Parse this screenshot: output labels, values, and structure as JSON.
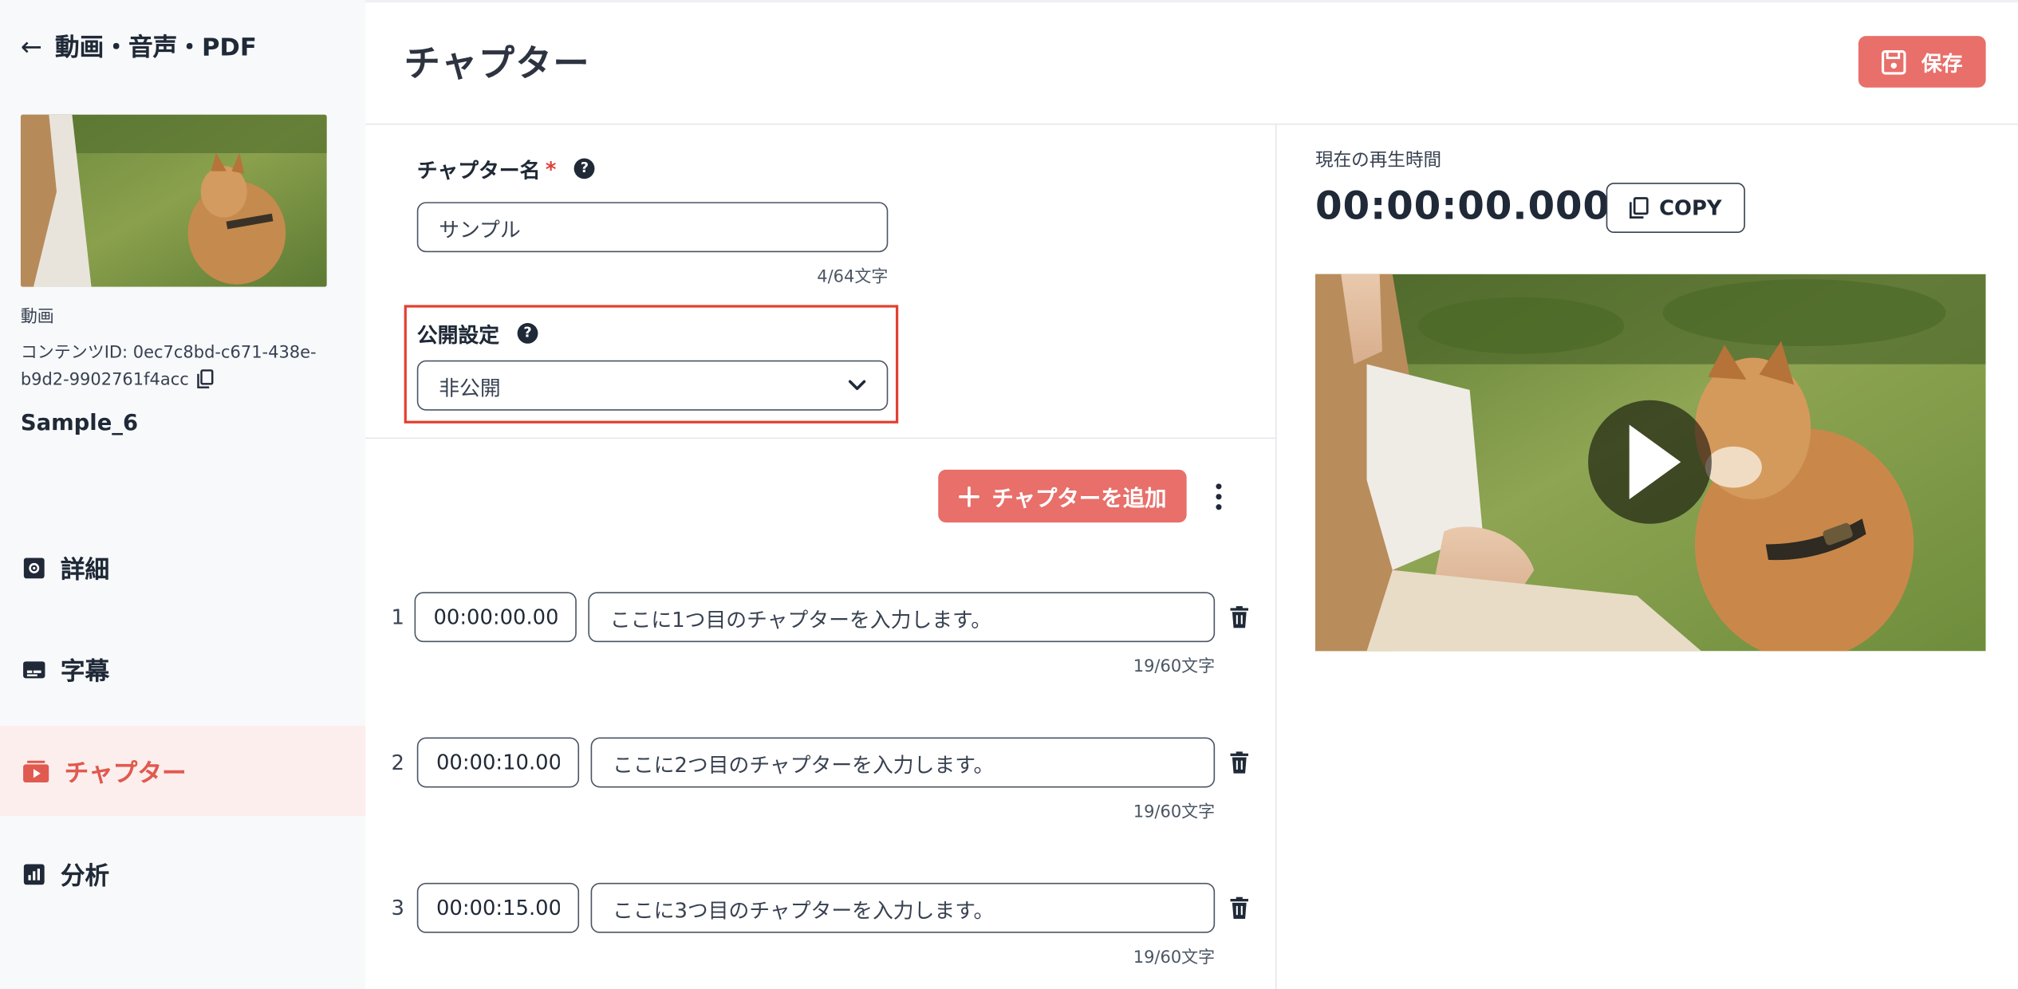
{
  "sidebar": {
    "back_title": "動画・音声・PDF",
    "content_type": "動画",
    "content_id": "コンテンツID: 0ec7c8bd-c671-438e-b9d2-9902761f4acc",
    "content_title": "Sample_6",
    "nav": [
      {
        "label": "詳細",
        "icon": "gear-icon",
        "active": false
      },
      {
        "label": "字幕",
        "icon": "subtitles-icon",
        "active": false
      },
      {
        "label": "チャプター",
        "icon": "chapter-icon",
        "active": true
      },
      {
        "label": "分析",
        "icon": "analytics-icon",
        "active": false
      }
    ]
  },
  "header": {
    "title": "チャプター",
    "save_label": "保存"
  },
  "form": {
    "name_label": "チャプター名",
    "name_required_mark": "*",
    "name_value": "サンプル",
    "name_count": "4/64文字",
    "publish_label": "公開設定",
    "publish_value": "非公開",
    "add_chapter_label": "チャプターを追加"
  },
  "chapters": [
    {
      "number": "1",
      "time": "00:00:00.000",
      "text": "ここに1つ目のチャプターを入力します。",
      "count": "19/60文字"
    },
    {
      "number": "2",
      "time": "00:00:10.000",
      "text": "ここに2つ目のチャプターを入力します。",
      "count": "19/60文字"
    },
    {
      "number": "3",
      "time": "00:00:15.000",
      "text": "ここに3つ目のチャプターを入力します。",
      "count": "19/60文字"
    }
  ],
  "player": {
    "current_time_label": "現在の再生時間",
    "current_time": "00:00:00.000",
    "copy_label": "COPY"
  },
  "colors": {
    "accent": "#e86f6a",
    "active_bg": "#fdeeee",
    "highlight_border": "#e2402f"
  }
}
